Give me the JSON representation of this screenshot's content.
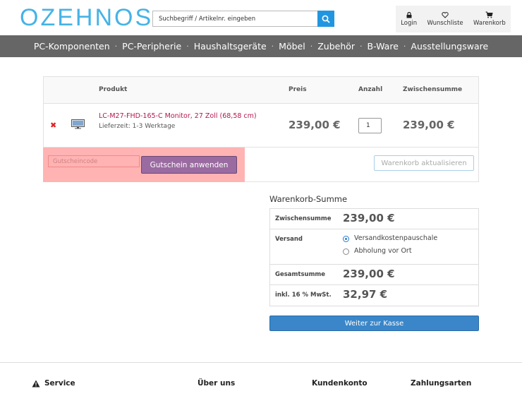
{
  "header": {
    "logo_text": "OZEHNOS",
    "search": {
      "placeholder": "Suchbegriff / Artikelnr. eingeben",
      "value": ""
    },
    "user_nav": [
      {
        "label": "Login",
        "icon": "lock-icon"
      },
      {
        "label": "Wunschliste",
        "icon": "heart-icon"
      },
      {
        "label": "Warenkorb",
        "icon": "cart-icon"
      }
    ]
  },
  "main_nav": [
    "PC-Komponenten",
    "PC-Peripherie",
    "Haushaltsgeräte",
    "Möbel",
    "Zubehör",
    "B-Ware",
    "Ausstellungsware"
  ],
  "cart": {
    "columns": {
      "product": "Produkt",
      "price": "Preis",
      "quantity": "Anzahl",
      "subtotal": "Zwischensumme"
    },
    "items": [
      {
        "name": "LC-M27-FHD-165-C Monitor, 27 Zoll (68,58 cm)",
        "delivery": "Lieferzeit: 1-3 Werktage",
        "price": "239,00 €",
        "quantity": "1",
        "subtotal": "239,00 €"
      }
    ],
    "coupon_placeholder": "Gutscheincode",
    "coupon_button": "Gutschein anwenden",
    "update_button": "Warenkorb aktualisieren"
  },
  "totals": {
    "title": "Warenkorb-Summe",
    "subtotal_label": "Zwischensumme",
    "subtotal_value": "239,00 €",
    "shipping_label": "Versand",
    "shipping_options": [
      {
        "label": "Versandkostenpauschale",
        "selected": true
      },
      {
        "label": "Abholung vor Ort",
        "selected": false
      }
    ],
    "total_label": "Gesamtsumme",
    "total_value": "239,00 €",
    "tax_label": "inkl. 16 % MwSt.",
    "tax_value": "32,97 €",
    "checkout_button": "Weiter zur Kasse"
  },
  "footer": {
    "columns": [
      "Service",
      "Über uns",
      "Kundenkonto",
      "Zahlungsarten"
    ]
  },
  "colors": {
    "logo": "#45b3e6",
    "nav_bg": "#666666",
    "product_link": "#b5164f",
    "coupon_button": "#9a6ba0",
    "checkout_button": "#3a86c8",
    "highlight": "#ffb3b3"
  }
}
